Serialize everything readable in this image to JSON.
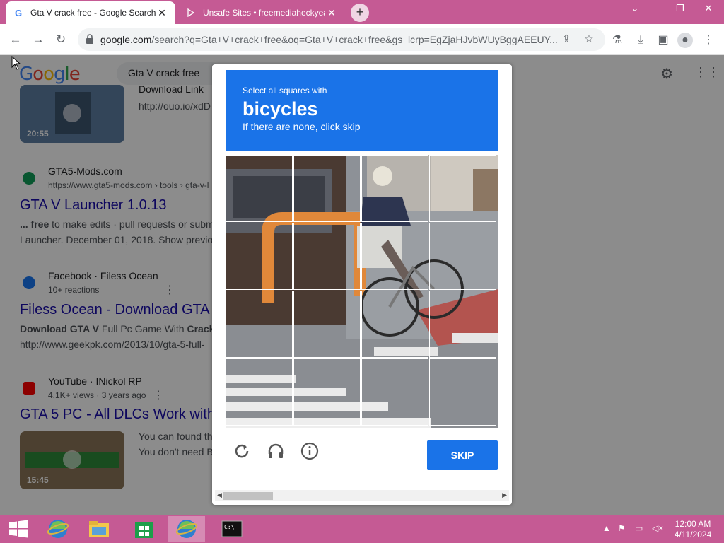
{
  "browser": {
    "tabs": [
      {
        "label": "Gta V crack free - Google Search",
        "close": "✕"
      },
      {
        "label": "Unsafe Sites • freemediaheckyeah",
        "close": "✕"
      }
    ],
    "new_tab": "+",
    "window_controls": {
      "minimize": "⌄",
      "restore": "❐",
      "close": "✕"
    },
    "url_host": "google.com",
    "url_path": "/search?q=Gta+V+crack+free&oq=Gta+V+crack+free&gs_lcrp=EgZjaHJvbWUyBggAEEUY..."
  },
  "google": {
    "logo": [
      "G",
      "o",
      "o",
      "g",
      "l",
      "e"
    ],
    "logo_colors": [
      "#4285f4",
      "#ea4335",
      "#fbbc05",
      "#4285f4",
      "#34a853",
      "#ea4335"
    ],
    "search_value": "Gta V crack free",
    "results": [
      {
        "kind": "video",
        "duration": "20:55",
        "cite_frag": "Download Link",
        "url_frag": "http://ouo.io/xdD"
      },
      {
        "source": "GTA5-Mods.com",
        "cite": "https://www.gta5-mods.com › tools › gta-v-l",
        "title": "GTA V Launcher 1.0.13",
        "snippet1_bold": "... free",
        "snippet1": " to make edits · pull requests or subm",
        "snippet2": "Launcher. December 01, 2018. Show previo"
      },
      {
        "source": "Facebook · Filess Ocean",
        "cite": "10+ reactions",
        "title": "Filess Ocean - Download GTA V",
        "snippet1_bold": "Download GTA V",
        "snippet1": " Full Pc Game With ",
        "snippet1_bold2": "Crack",
        "snippet2": "http://www.geekpk.com/2013/10/gta-5-full-"
      },
      {
        "source": "YouTube · INickol RP",
        "cite": "4.1K+ views · 3 years ago",
        "title": "GTA 5 PC - All DLCs Work with",
        "snippet1": "You can found th",
        "snippet2": "You don't need B",
        "duration": "15:45"
      }
    ],
    "side_frag1": "A",
    "side_frag2": "n"
  },
  "captcha": {
    "instruction": "Select all squares with",
    "target": "bicycles",
    "hint": "If there are none, click skip",
    "skip_label": "SKIP",
    "grid_size": 4
  },
  "taskbar": {
    "time": "12:00 AM",
    "date": "4/11/2024"
  }
}
